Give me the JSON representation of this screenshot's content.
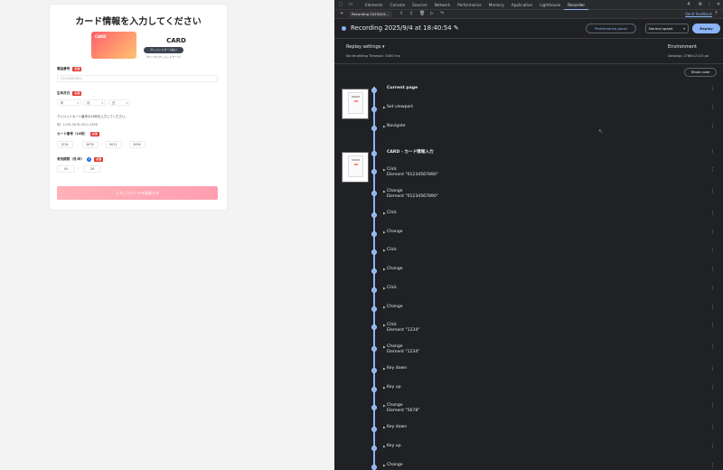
{
  "form": {
    "title": "カード情報を入力してください",
    "card_image_label": "CARD",
    "card_name": "CARD",
    "card_tag": "クレジットカード払い",
    "card_subtitle": "（サンプルクレジットカード）",
    "phone_label": "電話番号",
    "phone_required": "必須",
    "phone_placeholder": "01234567890",
    "dob_label": "生年月日",
    "dob_required": "必須",
    "dob_year": "年",
    "dob_month": "月",
    "dob_day": "日",
    "card_note": "クレジットカード番号の16桁を入力してください。",
    "card_example": "例）1234-5678-9012-3456",
    "card_number_label": "カード番号（16桁）",
    "card_number_required": "必須",
    "card_number_parts": [
      "1234",
      "5678",
      "9012",
      "3456"
    ],
    "card_number_sep": "-",
    "expiry_label": "有効期限（月/年）",
    "expiry_info": "?",
    "expiry_required": "必須",
    "expiry_month": "04",
    "expiry_sep": "/",
    "expiry_year": "26",
    "submit_label": "入力したカードを登録する"
  },
  "devtools": {
    "tabs": [
      "Elements",
      "Console",
      "Sources",
      "Network",
      "Performance",
      "Memory",
      "Application",
      "Lighthouse",
      "Recorder"
    ],
    "active_tab": "Recorder",
    "issue_badge": "4",
    "recording_select": "Recording 2025/9/4...",
    "send_feedback": "Send feedback",
    "recording_title": "Recording 2025/9/4 at 18:40:54",
    "performance_panel": "Performance panel",
    "speed": "Normal speed",
    "replay": "Replay",
    "replay_settings": "Replay settings",
    "replay_settings_detail": "No throttling   Timeout: 5000 ms",
    "environment": "Environment",
    "environment_detail": "Desktop   1766×2115 px",
    "show_code": "Show code",
    "sections": [
      {
        "title": "Current page",
        "steps": [
          {
            "name": "Set viewport",
            "detail": ""
          },
          {
            "name": "Navigate",
            "detail": ""
          }
        ]
      },
      {
        "title": "CARD - カード情報入力",
        "steps": [
          {
            "name": "Click",
            "detail": "Element \"01234567890\""
          },
          {
            "name": "Change",
            "detail": "Element \"01234567890\""
          },
          {
            "name": "Click",
            "detail": ""
          },
          {
            "name": "Change",
            "detail": ""
          },
          {
            "name": "Click",
            "detail": ""
          },
          {
            "name": "Change",
            "detail": ""
          },
          {
            "name": "Click",
            "detail": ""
          },
          {
            "name": "Change",
            "detail": ""
          },
          {
            "name": "Click",
            "detail": "Element \"1234\""
          },
          {
            "name": "Change",
            "detail": "Element \"1234\""
          },
          {
            "name": "Key down",
            "detail": ""
          },
          {
            "name": "Key up",
            "detail": ""
          },
          {
            "name": "Change",
            "detail": "Element \"5678\""
          },
          {
            "name": "Key down",
            "detail": ""
          },
          {
            "name": "Key up",
            "detail": ""
          },
          {
            "name": "Change",
            "detail": ""
          }
        ]
      }
    ]
  }
}
